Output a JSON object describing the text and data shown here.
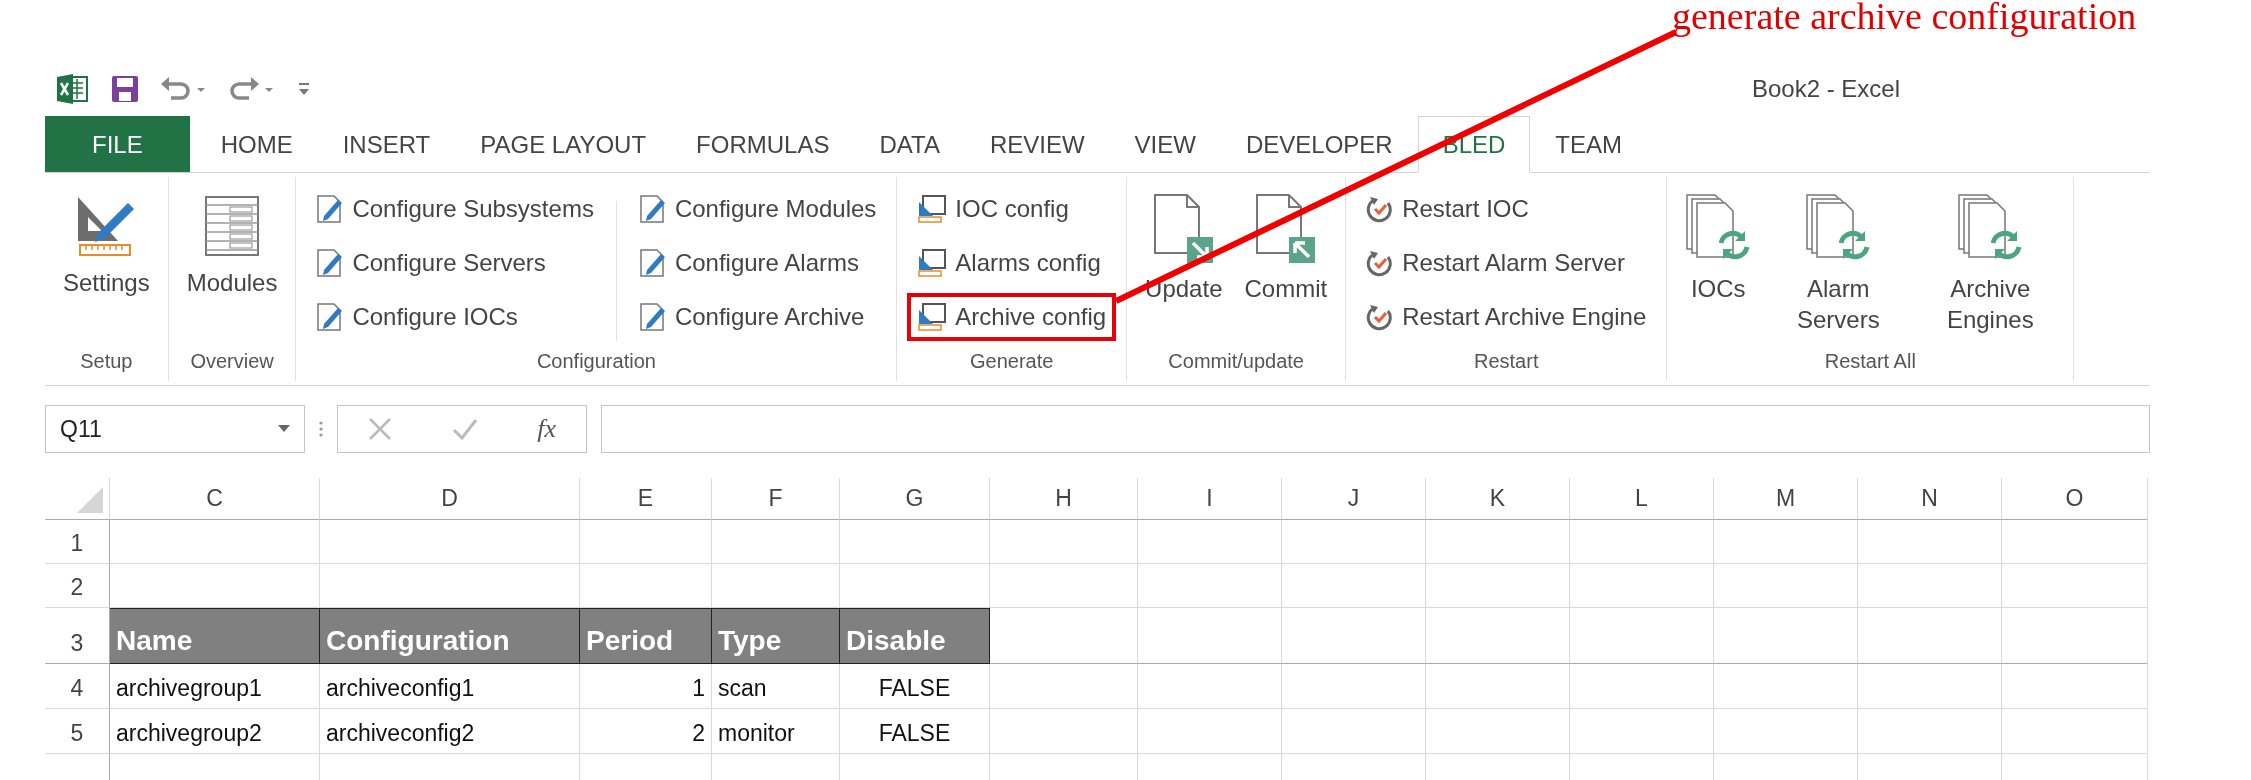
{
  "annotation": {
    "text": "generate archive configuration"
  },
  "window": {
    "title": "Book2 - Excel"
  },
  "tabs": [
    {
      "label": "FILE",
      "kind": "file",
      "selected": false
    },
    {
      "label": "HOME",
      "kind": "tab",
      "selected": false
    },
    {
      "label": "INSERT",
      "kind": "tab",
      "selected": false
    },
    {
      "label": "PAGE LAYOUT",
      "kind": "tab",
      "selected": false
    },
    {
      "label": "FORMULAS",
      "kind": "tab",
      "selected": false
    },
    {
      "label": "DATA",
      "kind": "tab",
      "selected": false
    },
    {
      "label": "REVIEW",
      "kind": "tab",
      "selected": false
    },
    {
      "label": "VIEW",
      "kind": "tab",
      "selected": false
    },
    {
      "label": "DEVELOPER",
      "kind": "tab",
      "selected": false
    },
    {
      "label": "BLED",
      "kind": "tab",
      "selected": true
    },
    {
      "label": "TEAM",
      "kind": "tab",
      "selected": false
    }
  ],
  "ribbon_groups": [
    {
      "label": "Setup",
      "kind": "large",
      "columns": [
        [
          {
            "label": "Settings",
            "highlighted": false
          }
        ]
      ]
    },
    {
      "label": "Overview",
      "kind": "large",
      "columns": [
        [
          {
            "label": "Modules",
            "highlighted": false
          }
        ]
      ]
    },
    {
      "label": "Configuration",
      "kind": "small",
      "columns": [
        [
          {
            "label": "Configure Subsystems",
            "highlighted": false
          },
          {
            "label": "Configure Servers",
            "highlighted": false
          },
          {
            "label": "Configure IOCs",
            "highlighted": false
          }
        ],
        [
          {
            "label": "Configure Modules",
            "highlighted": false
          },
          {
            "label": "Configure Alarms",
            "highlighted": false
          },
          {
            "label": "Configure Archive",
            "highlighted": false
          }
        ]
      ]
    },
    {
      "label": "Generate",
      "kind": "small",
      "columns": [
        [
          {
            "label": "IOC config",
            "highlighted": false
          },
          {
            "label": "Alarms config",
            "highlighted": false
          },
          {
            "label": "Archive config",
            "highlighted": true
          }
        ]
      ]
    },
    {
      "label": "Commit/update",
      "kind": "large",
      "columns": [
        [
          {
            "label": "Update",
            "highlighted": false
          }
        ],
        [
          {
            "label": "Commit",
            "highlighted": false
          }
        ]
      ]
    },
    {
      "label": "Restart",
      "kind": "small",
      "columns": [
        [
          {
            "label": "Restart IOC",
            "highlighted": false
          },
          {
            "label": "Restart Alarm Server",
            "highlighted": false
          },
          {
            "label": "Restart Archive Engine",
            "highlighted": false
          }
        ]
      ]
    },
    {
      "label": "Restart All",
      "kind": "large",
      "columns": [
        [
          {
            "label": "IOCs",
            "highlighted": false
          }
        ],
        [
          {
            "label": "Alarm Servers",
            "highlighted": false
          }
        ],
        [
          {
            "label": "Archive Engines",
            "highlighted": false
          }
        ]
      ]
    }
  ],
  "formula_bar": {
    "name_box": "Q11",
    "function_button": "fx"
  },
  "sheet": {
    "columns": [
      "C",
      "D",
      "E",
      "F",
      "G",
      "H",
      "I",
      "J",
      "K",
      "L",
      "M",
      "N",
      "O"
    ],
    "rows": [
      {
        "number": "1",
        "header": false,
        "cells": []
      },
      {
        "number": "2",
        "header": false,
        "cells": []
      },
      {
        "number": "3",
        "header": true,
        "cells": [
          "Name",
          "Configuration",
          "Period",
          "Type",
          "Disable"
        ]
      },
      {
        "number": "4",
        "header": false,
        "cells": [
          "archivegroup1",
          "archiveconfig1",
          "1",
          "scan",
          "FALSE"
        ]
      },
      {
        "number": "5",
        "header": false,
        "cells": [
          "archivegroup2",
          "archiveconfig2",
          "2",
          "monitor",
          "FALSE"
        ]
      }
    ]
  }
}
